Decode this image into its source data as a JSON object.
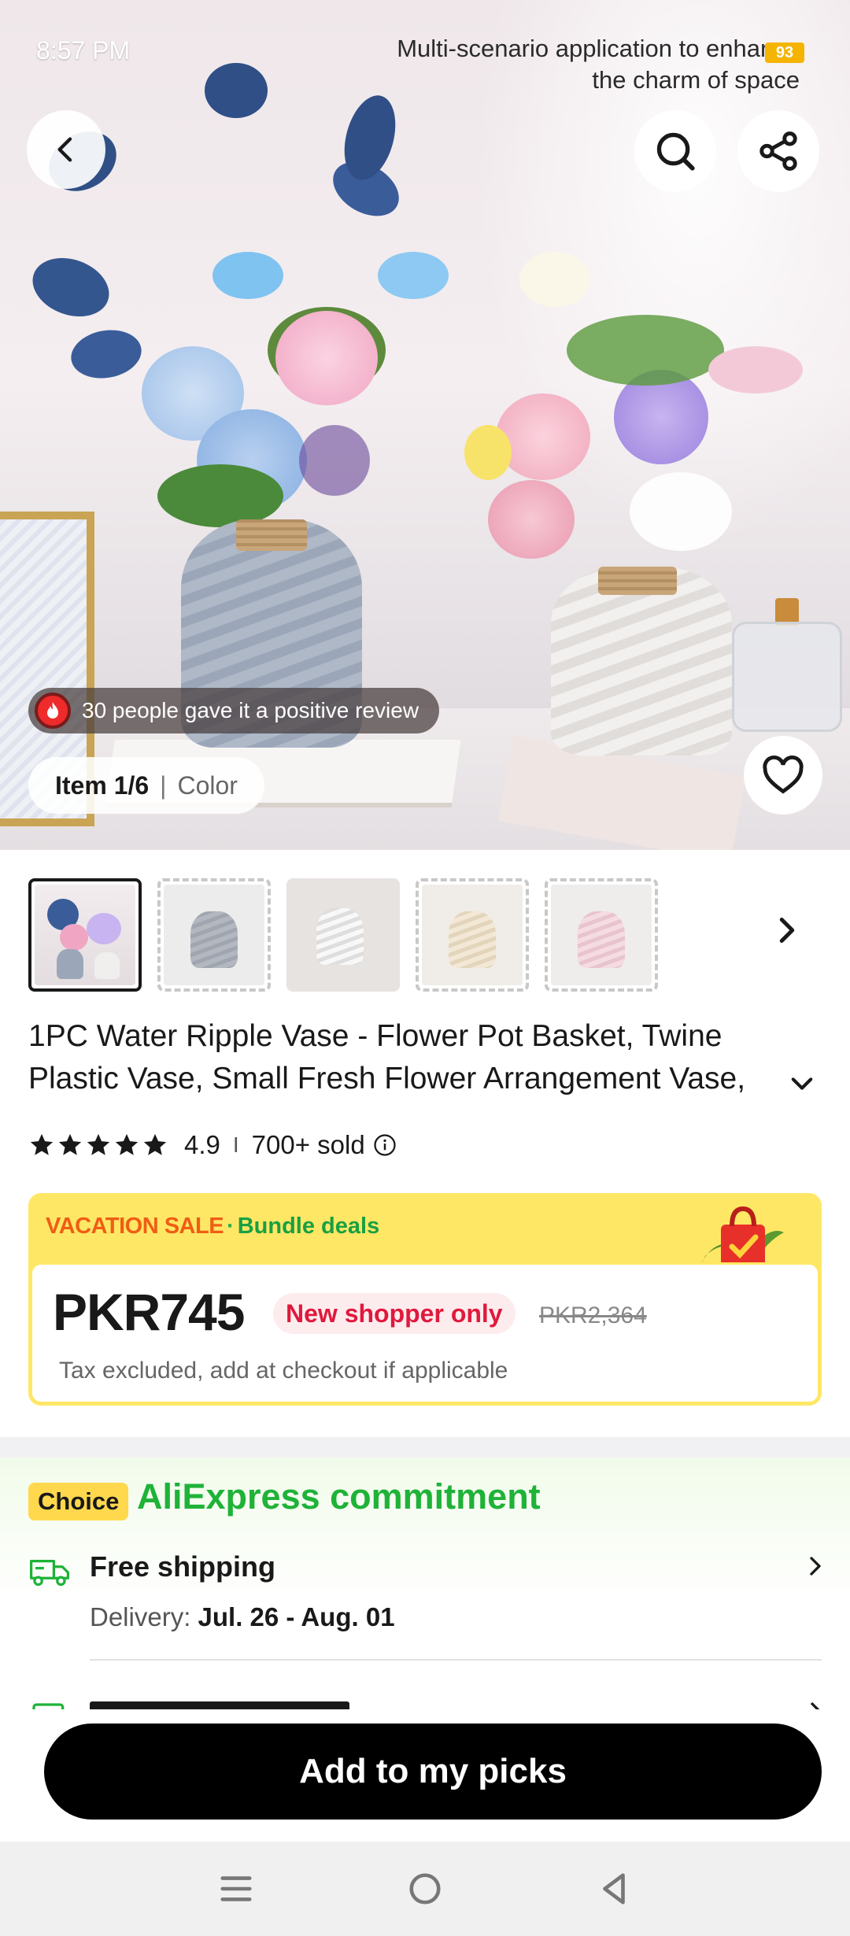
{
  "status": {
    "time": "8:57 PM",
    "battery": "93"
  },
  "hero": {
    "caption_line1": "Multi-scenario application to enhance",
    "caption_line2": "the charm of space",
    "review_text": "30 people gave it a positive review",
    "item_counter": "Item 1/6",
    "separator": "|",
    "variant_label": "Color"
  },
  "thumbnails": [
    {
      "kind": "main",
      "active": true
    },
    {
      "kind": "gray-vase",
      "color": "#a9aeb6"
    },
    {
      "kind": "white-vase",
      "color": "#eeeeee"
    },
    {
      "kind": "cream-vase",
      "color": "#efe3cf"
    },
    {
      "kind": "pink-vase",
      "color": "#f1d5dc"
    }
  ],
  "product": {
    "title": "1PC Water Ripple Vase - Flower Pot Basket, Twine Plastic Vase, Small Fresh Flower Arrangement Vase,",
    "rating": "4.9",
    "rating_divider": "I",
    "sold": "700+ sold",
    "star_count": 5
  },
  "sale": {
    "event": "VACATION SALE",
    "dot": "·",
    "bundle": "Bundle deals",
    "price": "PKR745",
    "badge": "New shopper only",
    "old_price": "PKR2,364",
    "tax_note": "Tax excluded, add at checkout if applicable"
  },
  "commitment": {
    "badge": "Choice",
    "title": "AliExpress commitment",
    "shipping_title": "Free shipping",
    "delivery_label": "Delivery:",
    "delivery_dates": "Jul. 26 - Aug. 01"
  },
  "cta": {
    "label": "Add to my picks"
  },
  "colors": {
    "accent_green": "#1fb238",
    "sale_yellow": "#ffe766",
    "sale_orange": "#f05d14",
    "badge_red": "#e0193c"
  },
  "icons": [
    "back-icon",
    "search-icon",
    "share-icon",
    "heart-icon",
    "fire-icon",
    "chevron-right-icon",
    "chevron-down-icon",
    "star-icon",
    "info-icon",
    "truck-icon",
    "menu-icon",
    "home-icon",
    "back-triangle-icon"
  ]
}
